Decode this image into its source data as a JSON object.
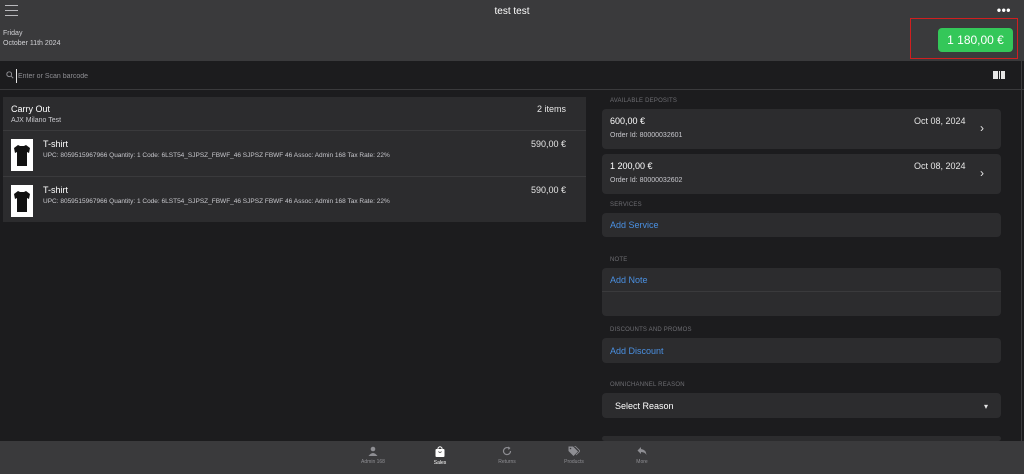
{
  "header": {
    "title": "test test",
    "more_label": "•••",
    "day": "Friday",
    "date": "October 11th 2024",
    "total": "1 180,00 €"
  },
  "search": {
    "placeholder": "Enter or Scan barcode"
  },
  "cart": {
    "type": "Carry Out",
    "store": "AJX Milano Test",
    "count": "2 items",
    "items": [
      {
        "name": "T-shirt",
        "description": "UPC: 8059515967966 Quantity: 1 Code: 6LST54_SJPSZ_FBWF_46 SJPSZ FBWF 46 Assoc: Admin 168 Tax Rate: 22%",
        "price": "590,00 €"
      },
      {
        "name": "T-shirt",
        "description": "UPC: 8059515967966 Quantity: 1 Code: 6LST54_SJPSZ_FBWF_46 SJPSZ FBWF 46 Assoc: Admin 168 Tax Rate: 22%",
        "price": "590,00 €"
      }
    ]
  },
  "deposits": {
    "label": "AVAILABLE DEPOSITS",
    "items": [
      {
        "amount": "600,00 €",
        "order": "Order Id: 80000032601",
        "date": "Oct 08, 2024"
      },
      {
        "amount": "1 200,00 €",
        "order": "Order Id: 80000032602",
        "date": "Oct 08, 2024"
      }
    ]
  },
  "services": {
    "label": "SERVICES",
    "action": "Add Service"
  },
  "note": {
    "label": "NOTE",
    "action": "Add Note"
  },
  "discounts": {
    "label": "DISCOUNTS AND PROMOS",
    "action": "Add Discount"
  },
  "omnichannel": {
    "label": "OMNICHANNEL REASON",
    "value": "Select Reason"
  },
  "tabs": [
    {
      "label": "Admin 168",
      "icon": "person-icon",
      "active": false
    },
    {
      "label": "Sales",
      "icon": "bag-icon",
      "active": true
    },
    {
      "label": "Returns",
      "icon": "refresh-icon",
      "active": false
    },
    {
      "label": "Products",
      "icon": "tags-icon",
      "active": false
    },
    {
      "label": "More",
      "icon": "reply-icon",
      "active": false
    }
  ],
  "colors": {
    "accent": "#4a90e2",
    "total_button": "#34c759",
    "highlight_frame": "#d01f1f"
  }
}
